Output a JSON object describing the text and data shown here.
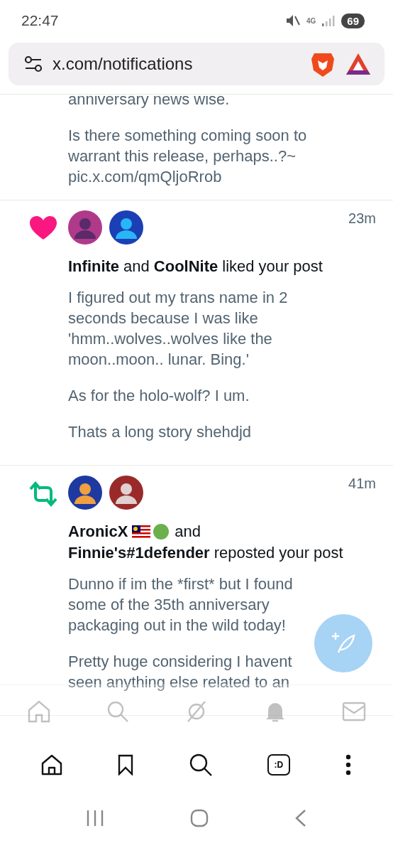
{
  "status_bar": {
    "time": "22:47",
    "network": "4G",
    "battery": "69"
  },
  "address_bar": {
    "url": "x.com/notifications"
  },
  "previous_post": {
    "lines": [
      "anniversary news wise.",
      "Is there something coming soon to warrant this release, perhaps..?~ pic.x.com/qmQljoRrob"
    ]
  },
  "notifications": [
    {
      "kind": "like",
      "time": "23m",
      "avatars": [
        {
          "kind": "picture"
        },
        {
          "kind": "picture"
        }
      ],
      "summary": [
        {
          "kind": "name",
          "text": "Infinite"
        },
        {
          "kind": "text",
          "text": "and"
        },
        {
          "kind": "name",
          "text": "CoolNite"
        },
        {
          "kind": "text",
          "text": "liked your post"
        }
      ],
      "body": [
        "I figured out my trans name in 2 seconds because I was like 'hmm..wolves..wolves like the moon..moon.. lunar. Bing.'",
        "As for the holo-wolf? I um.",
        "Thats a long story shehdjd"
      ]
    },
    {
      "kind": "repost",
      "time": "41m",
      "avatars": [
        {
          "kind": "picture"
        },
        {
          "kind": "picture"
        }
      ],
      "summary": [
        {
          "kind": "name",
          "text": "AronicX"
        },
        {
          "kind": "flag"
        },
        {
          "kind": "dot",
          "color": "#6ab04c"
        },
        {
          "kind": "text",
          "text": "and"
        },
        {
          "kind": "break"
        },
        {
          "kind": "name",
          "text": "Finnie's#1defender"
        },
        {
          "kind": "text",
          "text": "reposted your post"
        }
      ],
      "body": [
        "Dunno if im the *first* but I found some of the 35th anniversary packaging out in the wild today!",
        "Pretty huge considering I havent seen anything else related to an"
      ]
    }
  ],
  "browser_toolbar": {
    "tab_label": ":D"
  }
}
